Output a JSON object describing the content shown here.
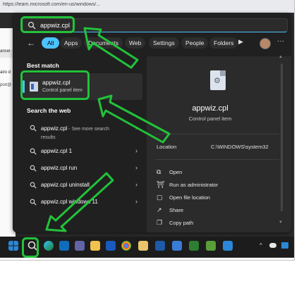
{
  "browser": {
    "url_text": "https://learn.microsoft.com/en-us/windows/...",
    "tab_label": "ancel",
    "side_text_1": "airo d",
    "side_text_2": "port@"
  },
  "search": {
    "query": "appwiz.cpl"
  },
  "filters": {
    "all": "All",
    "apps": "Apps",
    "documents": "Documents",
    "web": "Web",
    "settings": "Settings",
    "people": "People",
    "folders": "Folders",
    "more_glyph": "▶",
    "menu_glyph": "···"
  },
  "best_match": {
    "section_title": "Best match",
    "name": "appwiz.cpl",
    "type": "Control panel item"
  },
  "web": {
    "section_title": "Search the web",
    "items": [
      {
        "text": "appwiz.cpl",
        "sub": " - See more search results"
      },
      {
        "text": "appwiz.cpl 1"
      },
      {
        "text": "appwiz.cpl run"
      },
      {
        "text": "appwiz.cpl uninstall"
      },
      {
        "text": "appwiz.cpl windows 11"
      }
    ]
  },
  "detail": {
    "title": "appwiz.cpl",
    "subtitle": "Control panel item",
    "location_label": "Location",
    "location_value": "C:\\WINDOWS\\system32",
    "actions": [
      {
        "icon": "open-icon",
        "label": "Open"
      },
      {
        "icon": "shield-icon",
        "label": "Run as administrator"
      },
      {
        "icon": "folder-icon",
        "label": "Open file location"
      },
      {
        "icon": "share-icon",
        "label": "Share"
      },
      {
        "icon": "copy-icon",
        "label": "Copy path"
      }
    ]
  },
  "taskbar": {
    "apps": [
      "start",
      "search",
      "edge",
      "outlook",
      "teams",
      "word",
      "file-explorer",
      "chrome",
      "paint",
      "notes",
      "photos",
      "excel",
      "maps",
      "snipping-tool",
      "remote-desktop"
    ],
    "tray_up": "^"
  },
  "colors": {
    "accent": "#4cc2ff",
    "highlight": "#22c23a",
    "panel_bg": "#202020"
  }
}
